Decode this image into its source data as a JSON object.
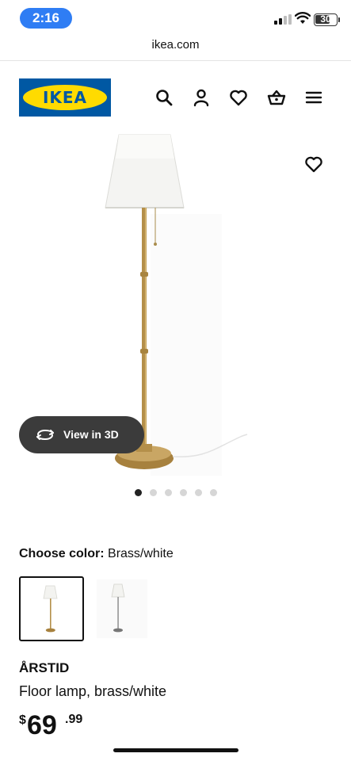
{
  "status_bar": {
    "time": "2:16",
    "battery": "30"
  },
  "browser": {
    "url": "ikea.com"
  },
  "header": {
    "logo_text": "IKEA",
    "brand_colors": {
      "blue": "#0058a3",
      "yellow": "#ffdb00"
    },
    "icons": [
      "search-icon",
      "account-icon",
      "wishlist-icon",
      "cart-icon",
      "menu-icon"
    ]
  },
  "gallery": {
    "view_3d_label": "View in 3D",
    "image_count": 6,
    "active_index": 0
  },
  "color_picker": {
    "label": "Choose color:",
    "selected_value": "Brass/white",
    "options_count": 2,
    "selected_index": 0
  },
  "product": {
    "name": "ÅRSTID",
    "description": "Floor lamp, brass/white",
    "price_currency": "$",
    "price_integer": "69",
    "price_decimal": ".99"
  }
}
